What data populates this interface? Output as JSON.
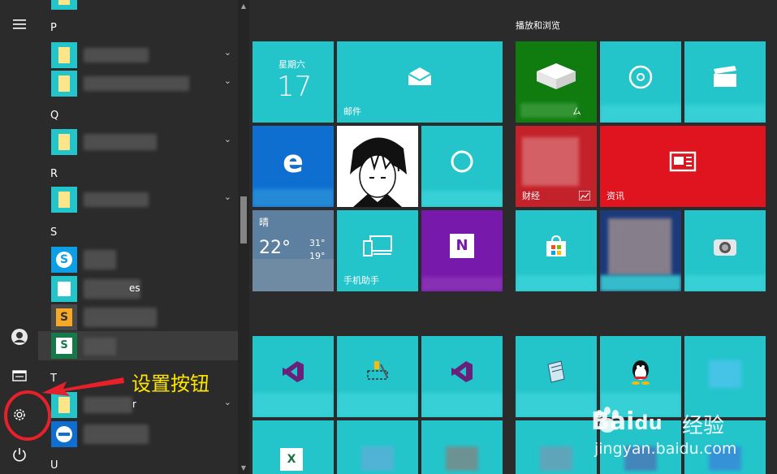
{
  "group_letters": [
    "P",
    "Q",
    "R",
    "S",
    "T",
    "U"
  ],
  "apps": {
    "s_partial_suffix": "es",
    "s_trunc_r": "r"
  },
  "tile_groups": {
    "play_title": "播放和浏览"
  },
  "tiles": {
    "calendar_weekday": "星期六",
    "calendar_day": "17",
    "mail_label": "邮件",
    "weather_condition": "晴",
    "weather_temp": "22°",
    "weather_high": "31°",
    "weather_low": "19°",
    "phone_assistant_label": "手机助手",
    "finance_label": "财经",
    "news_label": "资讯",
    "xbox_label_partial": "ㄙ"
  },
  "annotation": {
    "text": "设置按钮"
  },
  "watermark": {
    "brand_a": "Bai",
    "brand_b": "du",
    "brand_cn": "经验",
    "url": "jingyan.baidu.com"
  },
  "colors": {
    "accent_teal": "#23c5cb",
    "edge_blue": "#0e6fd1",
    "onenote_purple": "#7719aa",
    "news_red": "#e0141e",
    "xbox_green": "#107c10",
    "annotation_red": "#e8202a",
    "annotation_yellow": "#ffe500",
    "background": "#2b2b2b"
  }
}
